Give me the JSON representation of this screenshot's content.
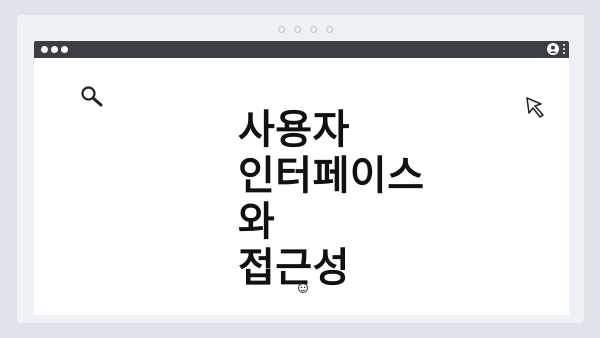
{
  "page": {
    "title": "사용자\n인터페이스와\n접근성"
  },
  "icons": {
    "search": "search-icon",
    "cursor": "cursor-arrow-icon",
    "face": "face-icon",
    "user": "user-icon",
    "menu": "kebab-menu-icon"
  },
  "colors": {
    "background": "#dfe3ea",
    "frame": "#eef1f5",
    "browser_bar": "#3b3e45",
    "content": "#ffffff",
    "text": "#111111"
  }
}
